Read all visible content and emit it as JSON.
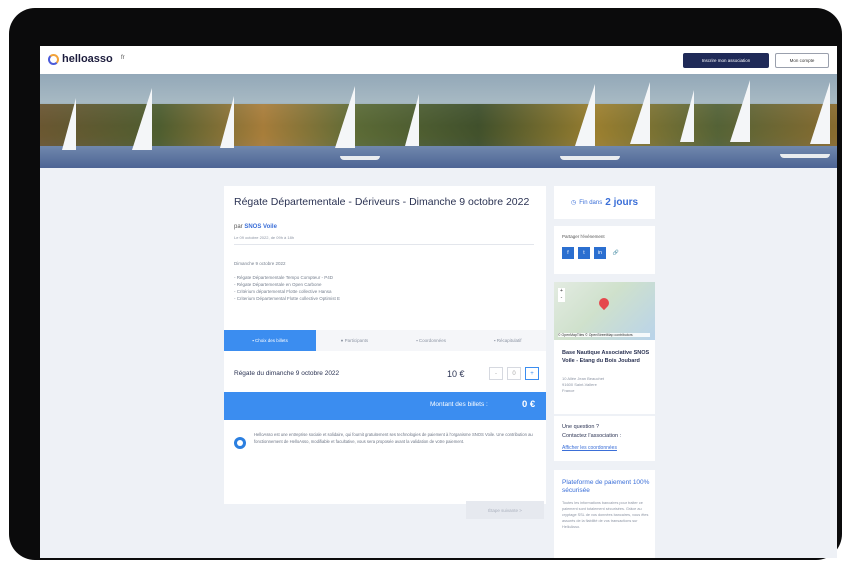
{
  "nav": {
    "logo_text": "helloasso",
    "lang": "fr",
    "assoc_button": "Inscrire mon association",
    "account_button": "Mon compte"
  },
  "event": {
    "title": "Régate Départementale - Dériveurs - Dimanche 9 octobre 2022",
    "by_prefix": "par",
    "organizer": "SNOS Voile",
    "meta": "Le 09 octobre 2022, de 09h à 18h",
    "description": [
      "Dimanche 9 octobre 2022",
      "",
      "- Régate Départementale Tempo Compteur - P4D",
      "- Régate Départementale en Open Carbone",
      "- Critérium départemental Flotte collective Hansa",
      "- Criterium Départemental Flotte collective Optimist E"
    ]
  },
  "steps": [
    "Choix des billets",
    "Participants",
    "Coordonnées",
    "Récapitulatif"
  ],
  "ticket": {
    "name": "Régate du dimanche 9 octobre 2022",
    "price": "10 €",
    "minus": "-",
    "qty": "0",
    "plus": "+"
  },
  "total": {
    "label": "Montant des billets :",
    "value": "0 €"
  },
  "notice": {
    "text": "HelloAsso est une entreprise sociale et solidaire, qui fournit gratuitement ses technologies de paiement à l'organisme SNOS Voile. Une contribution au fonctionnement de HelloAsso, modifiable et facultative, vous sera proposée avant la validation de votre paiement."
  },
  "next_button": "Étape suivante >",
  "sidebar": {
    "countdown_prefix": "Fin dans",
    "countdown_value": "2 jours",
    "share_label": "Partager l'événement",
    "share_icons": [
      "f",
      "t",
      "in",
      "🔗"
    ],
    "map_caption": "© OpenMapTiles © OpenStreetMap contributors",
    "zoom_in": "+",
    "zoom_out": "-",
    "address_name": "Base Nautique Associative SNOS Voile - Etang du Bois Joubard",
    "address_lines": [
      "10 Allée Jean Beauchet",
      "91600 Saint-Vallere",
      "France"
    ],
    "question_1": "Une question ?",
    "question_2": "Contactez l'association :",
    "question_link": "Afficher les coordonnées",
    "secure_title": "Plateforme de paiement 100% sécurisée",
    "secure_text": "Toutes les informations bancaires pour traiter ce paiement sont totalement sécurisées. Grâce au cryptage SSL de vos données bancaires, vous êtes assurés de la fiabilité de vos transactions sur HelloAsso."
  },
  "colors": {
    "accent": "#3b8df0",
    "nav_dark": "#1f2a58",
    "link": "#3b6fd8",
    "background": "#eef1f6"
  }
}
